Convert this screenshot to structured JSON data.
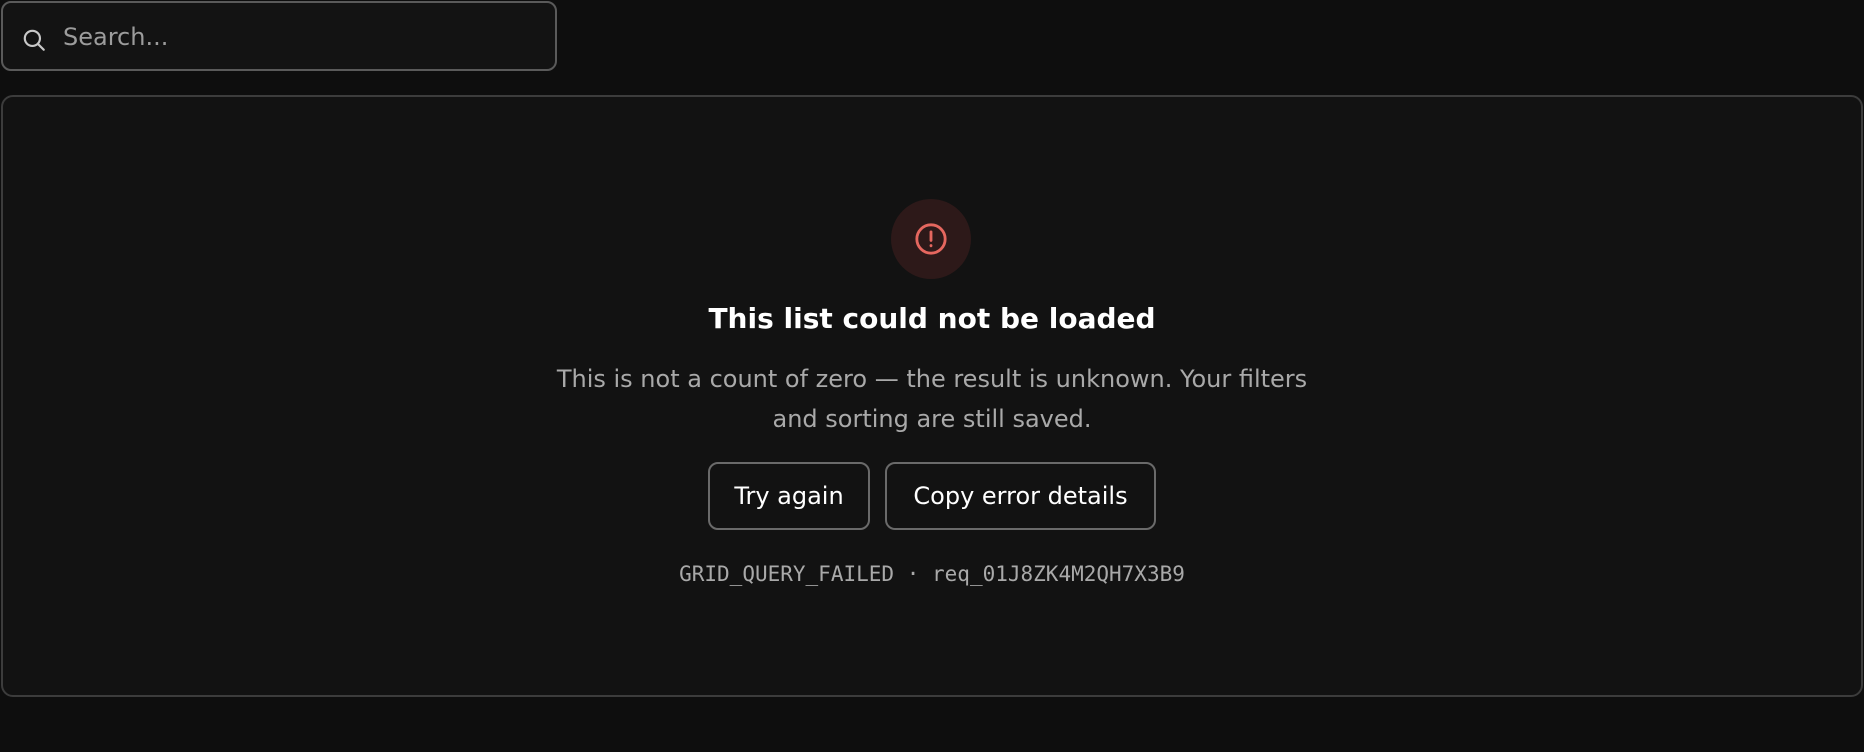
{
  "search": {
    "placeholder": "Search...",
    "value": ""
  },
  "error": {
    "icon": "alert-circle-icon",
    "accent_color": "#e5675f",
    "title": "This list could not be loaded",
    "message": "This is not a count of zero — the result is unknown. Your filters and sorting are still saved.",
    "retry_label": "Try again",
    "copy_label": "Copy error details",
    "code": "GRID_QUERY_FAILED",
    "separator": "·",
    "request_id": "req_01J8ZK4M2QH7X3B9"
  }
}
